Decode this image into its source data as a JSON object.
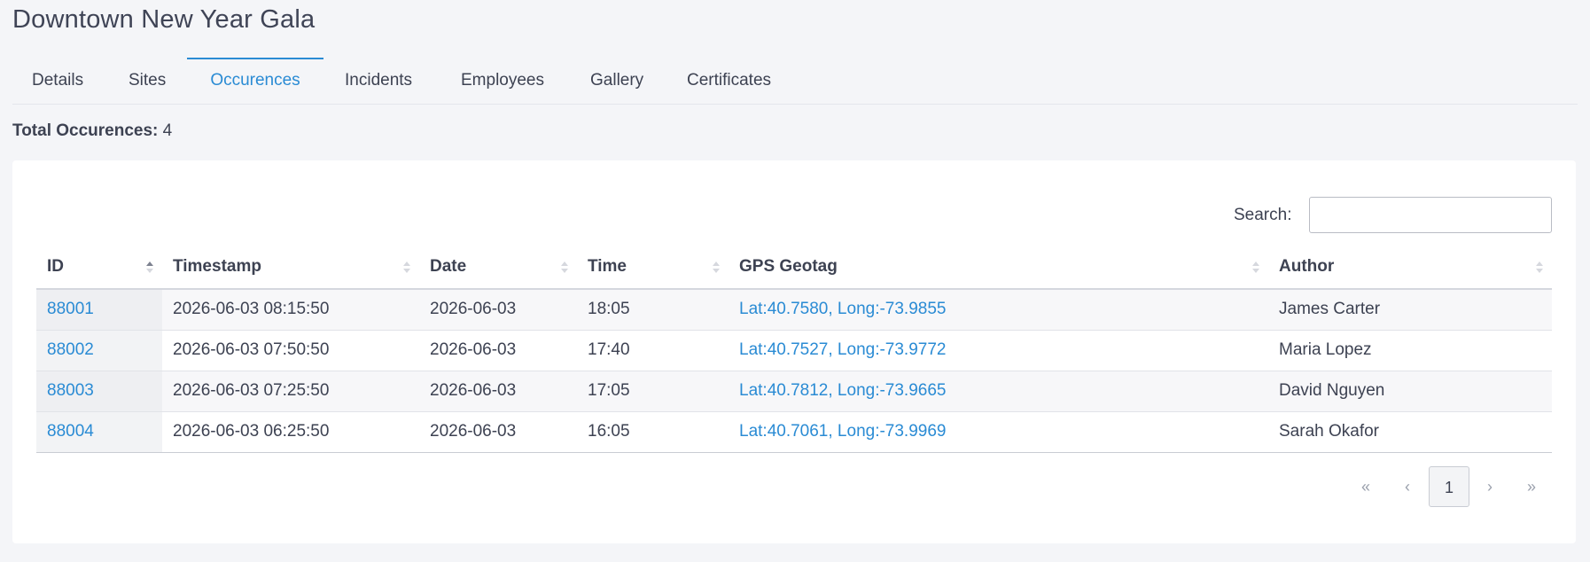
{
  "page": {
    "title": "Downtown New Year Gala"
  },
  "tabs": [
    {
      "label": "Details"
    },
    {
      "label": "Sites"
    },
    {
      "label": "Occurences"
    },
    {
      "label": "Incidents"
    },
    {
      "label": "Employees"
    },
    {
      "label": "Gallery"
    },
    {
      "label": "Certificates"
    }
  ],
  "active_tab": "Occurences",
  "summary": {
    "label": "Total Occurences:",
    "value": "4"
  },
  "search": {
    "label": "Search:",
    "value": "",
    "placeholder": ""
  },
  "table": {
    "columns": [
      {
        "label": "ID",
        "sort": "ascending"
      },
      {
        "label": "Timestamp",
        "sort": "none"
      },
      {
        "label": "Date",
        "sort": "none"
      },
      {
        "label": "Time",
        "sort": "none"
      },
      {
        "label": "GPS Geotag",
        "sort": "none"
      },
      {
        "label": "Author",
        "sort": "none"
      }
    ],
    "rows": [
      {
        "id": "88001",
        "timestamp": "2026-06-03 08:15:50",
        "date": "2026-06-03",
        "time": "18:05",
        "gps": "Lat:40.7580, Long:-73.9855",
        "author": "James Carter"
      },
      {
        "id": "88002",
        "timestamp": "2026-06-03 07:50:50",
        "date": "2026-06-03",
        "time": "17:40",
        "gps": "Lat:40.7527, Long:-73.9772",
        "author": "Maria Lopez"
      },
      {
        "id": "88003",
        "timestamp": "2026-06-03 07:25:50",
        "date": "2026-06-03",
        "time": "17:05",
        "gps": "Lat:40.7812, Long:-73.9665",
        "author": "David Nguyen"
      },
      {
        "id": "88004",
        "timestamp": "2026-06-03 06:25:50",
        "date": "2026-06-03",
        "time": "16:05",
        "gps": "Lat:40.7061, Long:-73.9969",
        "author": "Sarah Okafor"
      }
    ]
  },
  "pagination": {
    "first": "«",
    "prev": "‹",
    "current": "1",
    "next": "›",
    "last": "»"
  },
  "colors": {
    "accent": "#2a8bd4",
    "background": "#f4f5f8",
    "text": "#3d4252"
  }
}
